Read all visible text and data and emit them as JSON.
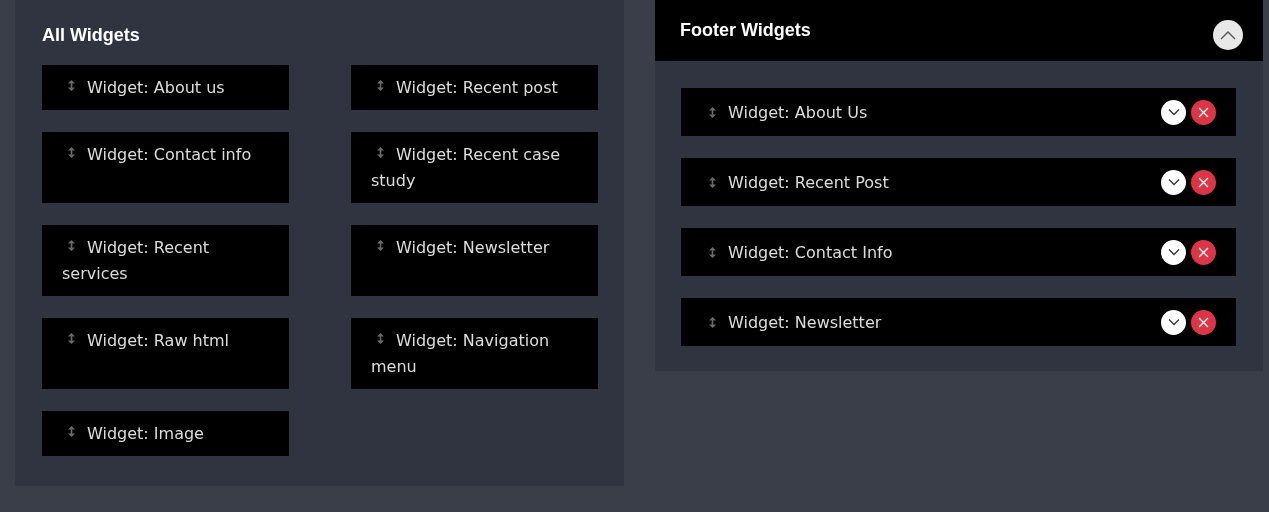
{
  "all_widgets": {
    "title": "All Widgets",
    "widgets": [
      {
        "label": "Widget: About us"
      },
      {
        "label": "Widget: Recent post"
      },
      {
        "label": "Widget: Contact info"
      },
      {
        "label": "Widget: Recent case study"
      },
      {
        "label": "Widget: Recent services"
      },
      {
        "label": "Widget: Newsletter"
      },
      {
        "label": "Widget: Raw html"
      },
      {
        "label": "Widget: Navigation menu"
      },
      {
        "label": "Widget: Image"
      }
    ]
  },
  "footer_widgets": {
    "title": "Footer Widgets",
    "expanded": true,
    "items": [
      {
        "label": "Widget: About Us"
      },
      {
        "label": "Widget: Recent Post"
      },
      {
        "label": "Widget: Contact Info"
      },
      {
        "label": "Widget: Newsletter"
      }
    ]
  }
}
